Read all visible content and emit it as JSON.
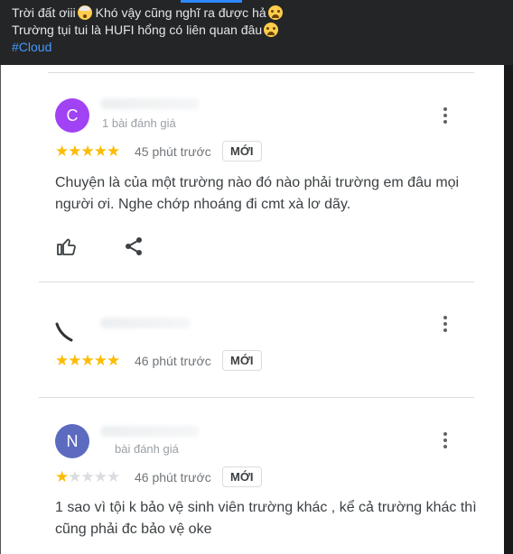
{
  "post": {
    "line1": "Trời đất ơiii",
    "line1_b": " Khó vậy cũng nghĩ ra được hả",
    "line2": "Trường tụi tui là HUFI hổng có liên quan đâu",
    "hashtag": "#Cloud"
  },
  "reviews": [
    {
      "avatar_letter": "C",
      "avatar_color": "#a142f4",
      "meta": "1 bài đánh giá",
      "rating": 5,
      "time": "45 phút trước",
      "badge": "MỚI",
      "text": "Chuyện là của một trường nào đó nào phải trường em đâu mọi người ơi. Nghe chớp nhoáng đi cmt xà lơ dãy."
    },
    {
      "rating": 5,
      "time": "46 phút trước",
      "badge": "MỚI"
    },
    {
      "avatar_letter": "N",
      "avatar_color": "#5c6bc0",
      "meta": "bài đánh giá",
      "rating": 1,
      "time": "46 phút trước",
      "badge": "MỚI",
      "text": "1 sao vì tội k bảo vệ sinh viên trường khác , kể cả trường khác thì cũng phải đc bảo vệ oke"
    }
  ],
  "colors": {
    "star_on": "#fbbc04",
    "star_off": "#dadce0"
  },
  "icons": {
    "like": "thumbs-up-icon",
    "share": "share-icon",
    "menu": "more-vert-icon"
  }
}
